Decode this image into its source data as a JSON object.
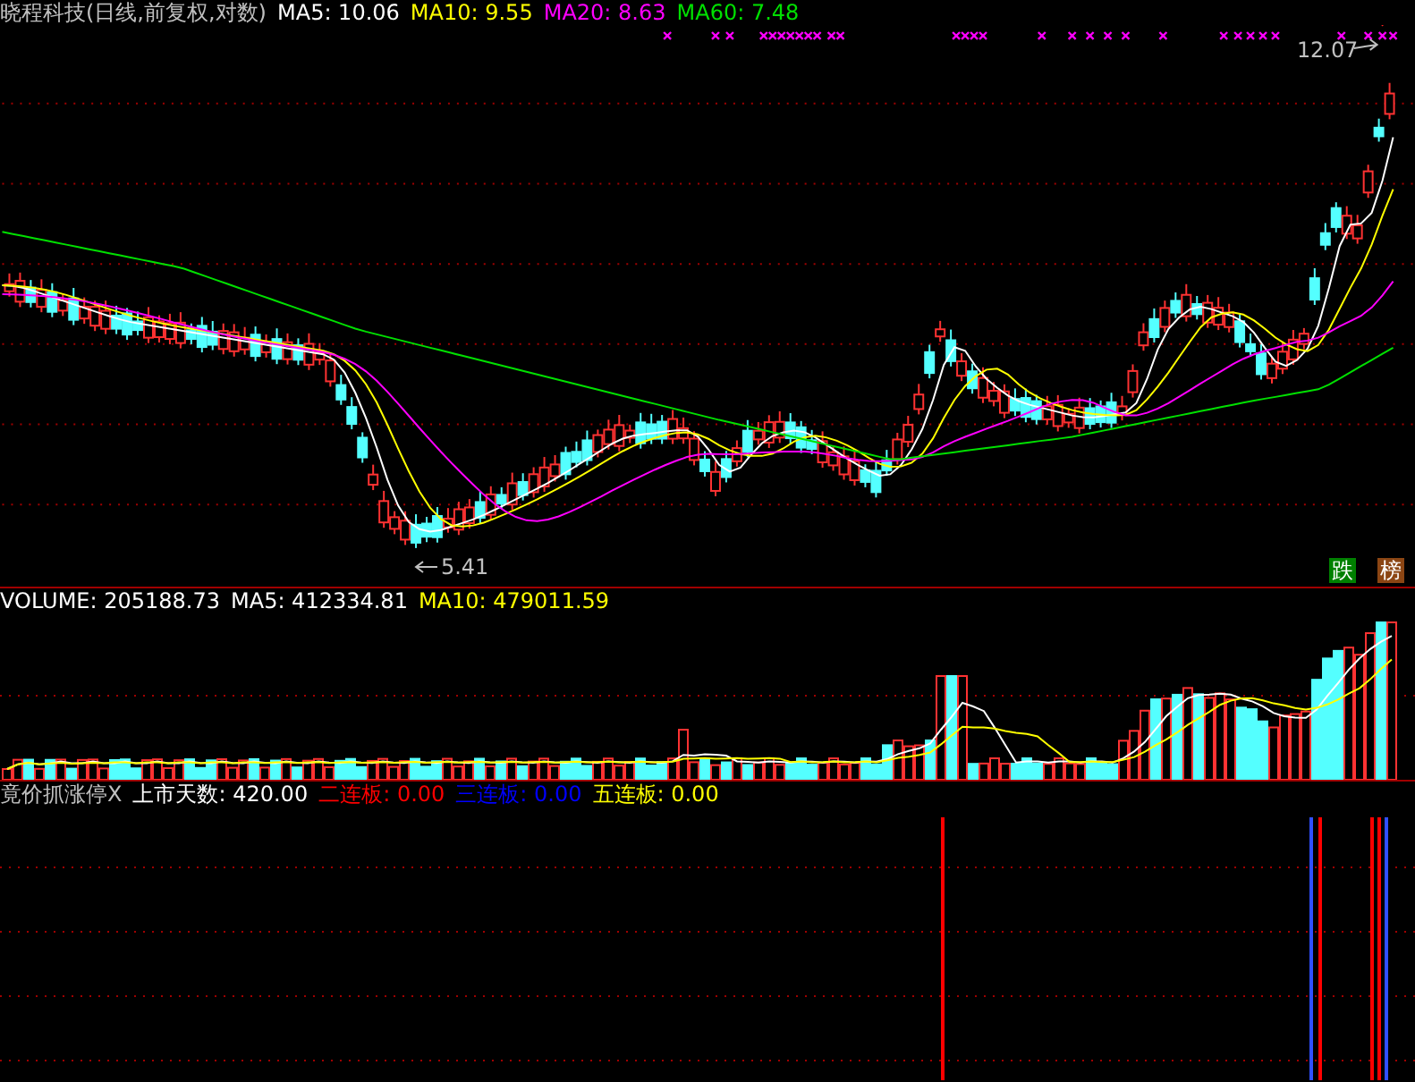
{
  "price_panel": {
    "title": "晓程科技(日线,前复权,对数)",
    "averages": [
      {
        "label": "MA5: 10.06",
        "color": "#ffffff"
      },
      {
        "label": "MA10: 9.55",
        "color": "#ffff00"
      },
      {
        "label": "MA20: 8.63",
        "color": "#ff00ff"
      },
      {
        "label": "MA60: 7.48",
        "color": "#00e000"
      }
    ],
    "high_label": "12.07",
    "low_label": "5.41",
    "badges": [
      {
        "label": "跌",
        "color": "#008000"
      },
      {
        "label": "榜",
        "color": "#8b4513"
      }
    ]
  },
  "volume_panel": {
    "readings": [
      {
        "label": "VOLUME: 205188.73",
        "color": "#ffffff"
      },
      {
        "label": "MA5: 412334.81",
        "color": "#ffffff"
      },
      {
        "label": "MA10: 479011.59",
        "color": "#ffff00"
      }
    ]
  },
  "indicator_panel": {
    "readings": [
      {
        "label": "竟价抓涨停X",
        "color": "#c0c0c0"
      },
      {
        "label": "上市天数: 420.00",
        "color": "#ffffff"
      },
      {
        "label": "二连板: 0.00",
        "color": "#ff0000"
      },
      {
        "label": "三连板: 0.00",
        "color": "#0000ff"
      },
      {
        "label": "五连板: 0.00",
        "color": "#ffff00"
      }
    ]
  }
}
